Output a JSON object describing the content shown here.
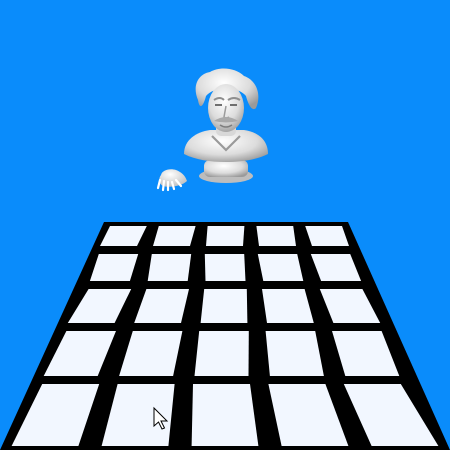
{
  "scene": {
    "background_color": "#0a8cfb",
    "board": {
      "rows": 5,
      "cols": 5,
      "tile_color": "#f2f7ff",
      "grid_color": "#000000"
    },
    "objects": [
      {
        "name": "bust-statue",
        "color": "#e6e6e6"
      },
      {
        "name": "hand-object",
        "color": "#f0f0f0"
      }
    ]
  },
  "cursor": {
    "icon": "mouse-pointer-icon",
    "color": "#ffffff"
  }
}
